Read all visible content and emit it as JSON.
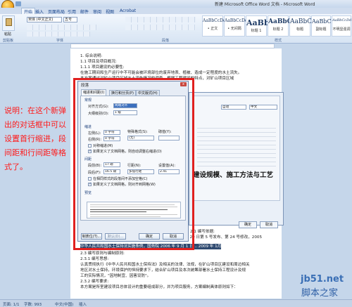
{
  "window": {
    "title": "新建 Microsoft Office Word 文档 - Microsoft Word"
  },
  "tabs": [
    "开始",
    "插入",
    "页面布局",
    "引用",
    "邮件",
    "审阅",
    "视图",
    "Acrobat"
  ],
  "ribbon": {
    "paste_label": "粘贴",
    "clipboard_label": "剪贴板",
    "font_name": "宋体 (中文正文)",
    "font_size": "五号",
    "font_group_label": "字体",
    "paragraph_group_label": "段落",
    "styles_group_label": "样式",
    "styles": [
      {
        "preview": "AaBbCcDd",
        "name": "• 正文"
      },
      {
        "preview": "AaBbCcDd",
        "name": "• 无间隔"
      },
      {
        "preview": "AaBb",
        "name": "标题 1"
      },
      {
        "preview": "AaBbC",
        "name": "标题 2"
      },
      {
        "preview": "AaBbC",
        "name": "标题"
      },
      {
        "preview": "AaBbC",
        "name": "副标题"
      },
      {
        "preview": "AaBbCcDd",
        "name": "不明显强调"
      }
    ]
  },
  "document": {
    "lines_top": [
      "1. 综合说明:",
      "1.1 项目及项目概况:",
      "1.1.1 项目建设的必要性:",
      "在施工期间和生产运行中不可能会被环境部位的废弃地表、植被、造成一定程度的水土流失。",
      "本方案通过对矿山项目区域水土流失情况的调查，根据工程建设的特点，对矿山项目区域"
    ],
    "lines_bottom": [
      "2.1 编写依据:",
      "2.1.1 法律法规：《中华人民共和国水土保持法》1991 年 6 月 29 日第 5 号发布、第 24 号修改，2005",
      "中华人民共和国水土保持法实施条例，国务院 2006 年 9 月 1 日... 2009 年 1月 1",
      "2.3 编写原则与编制原则:",
      "2.3.1 编写思想:",
      "认真贯彻执行《中华人民共和国水土保持法》及相关的法律、法规，在矿山项目区建设和周边相关",
      "地区对水土保持，环境保护的恒持要求下，结合矿山项目及本次统筹部署水土保持工程设计及规",
      "工的实际情况，\"因地制宜、因害设防\"。",
      "2.3.2 编写要求:",
      "本方案是所室建设项目总体设计的重要组成部分，并为项目服务，方案编制具体原则如下："
    ]
  },
  "annotation": "说明：在这个新弹出的对话框中可以设置首行缩进，段间距和行间距等格式了。",
  "background_dialog": {
    "heading_text": "建设规模、施工方法与工艺",
    "font_value": "中文",
    "auto_value": "自动",
    "ok_label": "确定",
    "cancel_label": "取消"
  },
  "dialog": {
    "title": "段落",
    "close_label": "x",
    "tabs": [
      "缩进和间距(I)",
      "换行和分页(P)",
      "中文版式(H)"
    ],
    "general_section": "常规",
    "alignment_label": "对齐方式(G):",
    "alignment_value": "两端对齐",
    "outline_label": "大纲级别(O):",
    "outline_value": "1 级",
    "indent_section": "缩进",
    "left_label": "左侧(L):",
    "left_value": "0 字符",
    "right_label": "右侧(R):",
    "right_value": "0 字符",
    "special_label": "特殊格式(S):",
    "special_value": "(无)",
    "by_label": "磅值(Y):",
    "mirror_label": "对称缩进(M)",
    "auto_right_label": "如果定义了文档网格，则自动调整右缩进(D)",
    "spacing_section": "间距",
    "before_label": "段前(B):",
    "before_value": "17 磅",
    "after_label": "段后(F):",
    "after_value": "16.5 磅",
    "line_spacing_label": "行距(N):",
    "line_spacing_value": "多倍行距",
    "at_label": "设置值(A):",
    "at_value": "2.41",
    "no_space_label": "在相同样式的段落间不添加空格(C)",
    "snap_grid_label": "如果定义了文档网格，则对齐到网格(W)",
    "preview_section": "预览",
    "tabs_button": "制表位(T)...",
    "default_button": "默认(D)...",
    "ok_button": "确定",
    "cancel_button": "取消"
  },
  "status_bar": {
    "page": "页面: 1/1",
    "words": "字数: 993",
    "language": "中文(中国)",
    "insert": "插入"
  },
  "watermark": {
    "line1": "jb51.net",
    "line2": "脚本之家"
  }
}
